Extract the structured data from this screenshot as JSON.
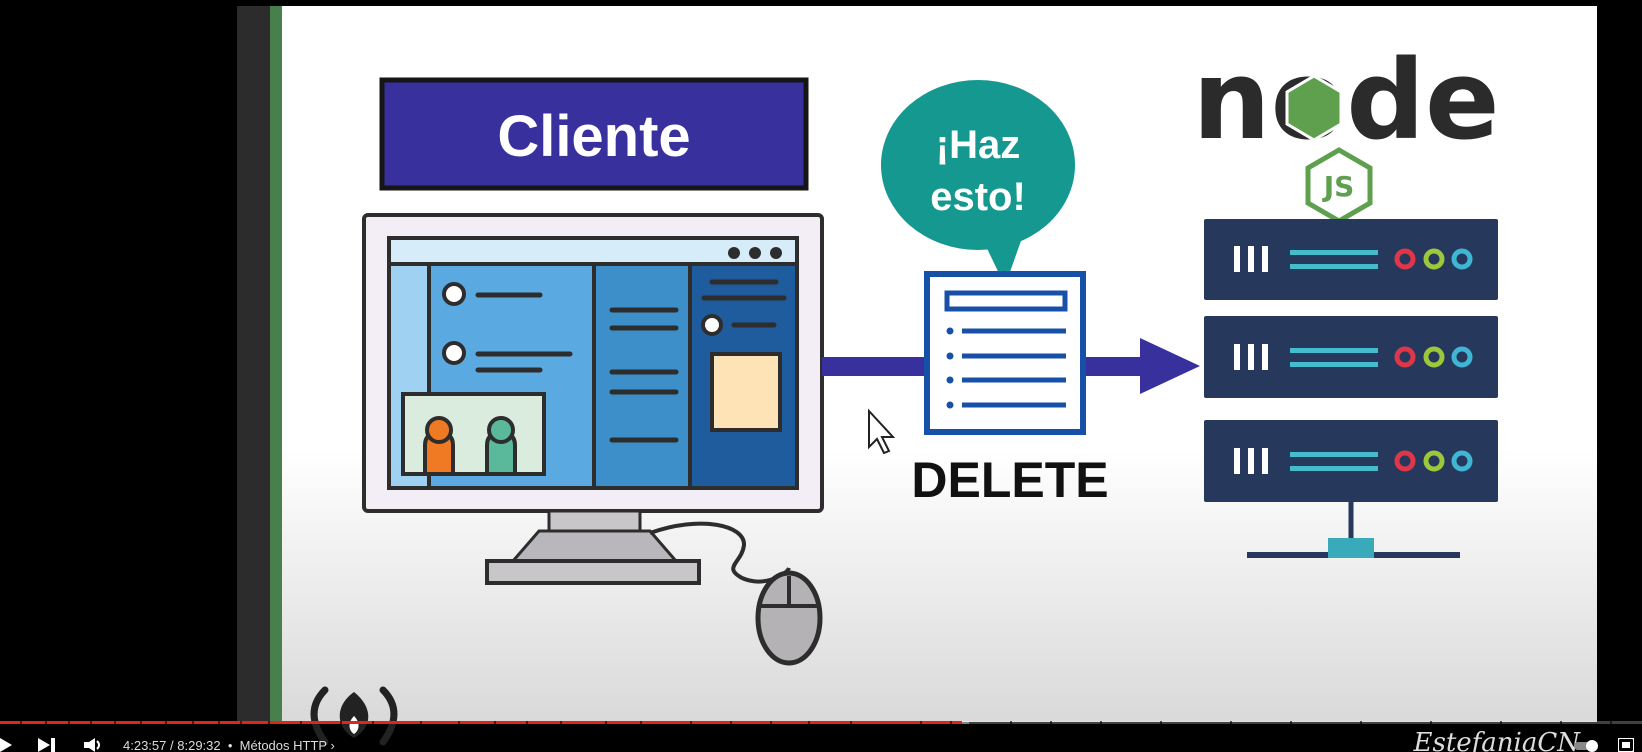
{
  "slide": {
    "client_label": "Cliente",
    "bubble_line1": "¡Haz",
    "bubble_line2": "esto!",
    "method_label": "DELETE",
    "node_logo_text": "node",
    "node_js_badge": "JS",
    "colors": {
      "client_banner": "#38309c",
      "arrow": "#38309c",
      "bubble": "#14988f",
      "server": "#26395d",
      "document_border": "#1650a7",
      "node_green": "#5fa04e",
      "node_dark": "#2b2b2b",
      "left_accent_bar": "#47804a"
    }
  },
  "player": {
    "time_current": "4:23:57",
    "time_total": "8:29:32",
    "separator": "/",
    "chapter": "Métodos HTTP",
    "watermark": "EstefaniaCN",
    "progress_fraction": 0.586,
    "buffer_fraction": 0.59,
    "icons": [
      "play-icon",
      "next-icon",
      "volume-icon",
      "chapter-chevron-icon",
      "autoplay-toggle-icon",
      "settings-icon"
    ]
  }
}
